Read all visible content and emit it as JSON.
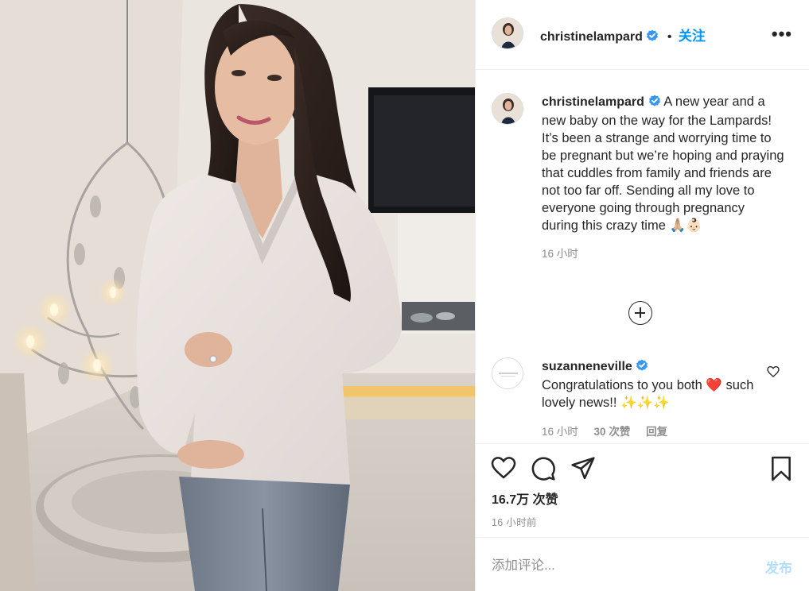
{
  "post": {
    "username": "christinelampard",
    "follow_label": "关注",
    "more_label": "•••",
    "caption_username": "christinelampard",
    "caption_text": "A new year and a new baby on the way for the Lampards! It’s been a strange and worrying time to be pregnant but we’re hoping and praying that cuddles from family and friends are not too far off. Sending all my love to everyone going through pregnancy during this crazy time 🙏🏼👶🏻",
    "caption_time": "16 小时",
    "likes": "16.7万 次赞",
    "post_time": "16 小时前"
  },
  "comments": [
    {
      "username": "suzanneneville",
      "text": "Congratulations to you both ❤️ such lovely news!! ✨✨✨",
      "time": "16 小时",
      "likes": "30 次赞",
      "reply_label": "回复"
    }
  ],
  "composer": {
    "placeholder": "添加评论...",
    "publish_label": "发布"
  },
  "icons": {
    "verified": "verified-badge-icon",
    "like": "heart-icon",
    "comment": "comment-icon",
    "share": "paper-plane-icon",
    "save": "bookmark-icon",
    "load_more": "plus-circle-icon"
  },
  "colors": {
    "accent": "#0095f6",
    "muted": "#8e8e8e",
    "publish_disabled": "#b2dffc",
    "heart_emoji": "#e0245e"
  }
}
